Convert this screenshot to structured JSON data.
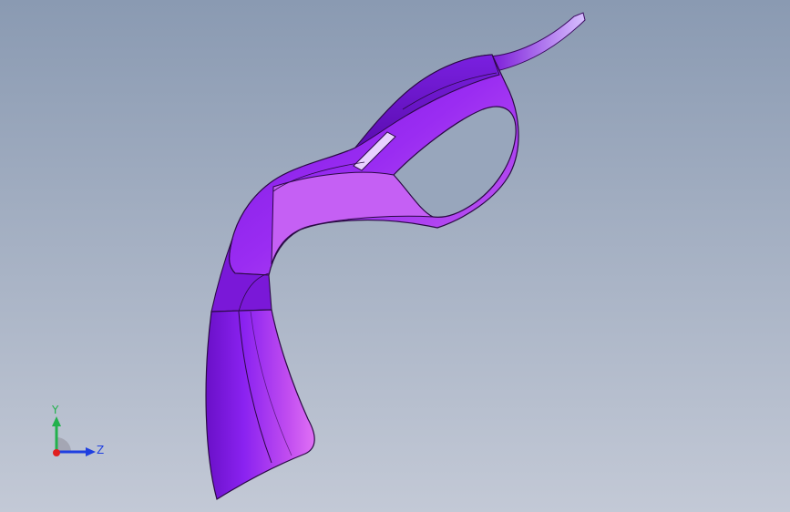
{
  "viewport": {
    "background_top": "#8a9ab2",
    "background_bottom": "#c3c9d6"
  },
  "model": {
    "part_color": "#8a1fe0",
    "edge_color": "#2a0a44"
  },
  "triad": {
    "y_label": "Y",
    "z_label": "Z",
    "y_color": "#22b14c",
    "z_color": "#1f3fe0",
    "x_color": "#e01f1f"
  }
}
